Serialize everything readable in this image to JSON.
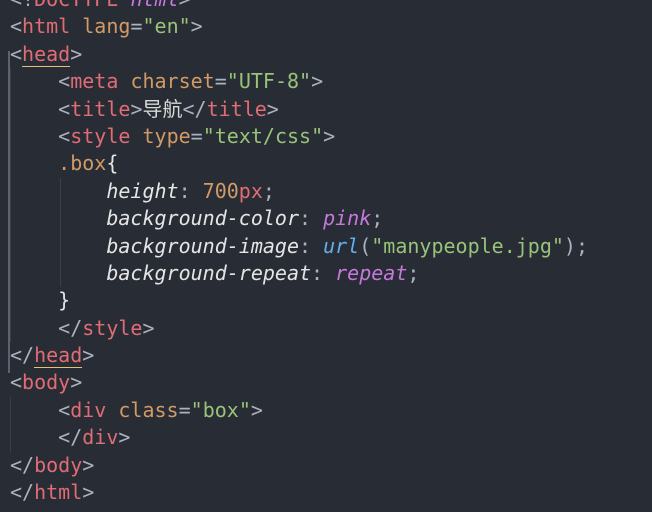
{
  "editor": {
    "lines": [
      {
        "id": "l1",
        "parts": [
          "<!",
          "DOCTYPE",
          " ",
          "html",
          ">"
        ]
      },
      {
        "id": "l2",
        "parts": [
          "<",
          "html",
          " ",
          "lang",
          "=",
          "\"en\"",
          ">"
        ]
      },
      {
        "id": "l3",
        "parts": [
          "<",
          "head",
          ">"
        ]
      },
      {
        "id": "l4",
        "parts": [
          "<",
          "meta",
          " ",
          "charset",
          "=",
          "\"UTF-8\"",
          ">"
        ]
      },
      {
        "id": "l5",
        "parts": [
          "<",
          "title",
          ">",
          "导航",
          "</",
          "title",
          ">"
        ]
      },
      {
        "id": "l6",
        "parts": [
          "<",
          "style",
          " ",
          "type",
          "=",
          "\"text/css\"",
          ">"
        ]
      },
      {
        "id": "l7",
        "parts": [
          ".box",
          "{"
        ]
      },
      {
        "id": "l8",
        "parts": [
          "height",
          ": ",
          "700",
          "px",
          ";"
        ]
      },
      {
        "id": "l9",
        "parts": [
          "background-color",
          ": ",
          "pink",
          ";"
        ]
      },
      {
        "id": "l10",
        "parts": [
          "background-image",
          ": ",
          "url",
          "(",
          "\"manypeople.jpg\"",
          ");"
        ]
      },
      {
        "id": "l11",
        "parts": [
          "background-repeat",
          ": ",
          "repeat",
          ";"
        ]
      },
      {
        "id": "l12",
        "parts": [
          "}"
        ]
      },
      {
        "id": "l13",
        "parts": [
          "</",
          "style",
          ">"
        ]
      },
      {
        "id": "l14",
        "parts": [
          "</",
          "head",
          ">"
        ]
      },
      {
        "id": "l15",
        "parts": [
          "<",
          "body",
          ">"
        ]
      },
      {
        "id": "l16",
        "parts": [
          "<",
          "div",
          " ",
          "class",
          "=",
          "\"box\"",
          ">"
        ]
      },
      {
        "id": "l17",
        "parts": [
          "</",
          "div",
          ">"
        ]
      },
      {
        "id": "l18",
        "parts": [
          "</",
          "body",
          ">"
        ]
      },
      {
        "id": "l19",
        "parts": [
          "</",
          "html",
          ">"
        ]
      }
    ]
  },
  "colors": {
    "background": "#282c34",
    "tag": "#e06c75",
    "attribute": "#d19a66",
    "string": "#98c379",
    "keyword": "#c678dd",
    "function": "#61afef"
  }
}
